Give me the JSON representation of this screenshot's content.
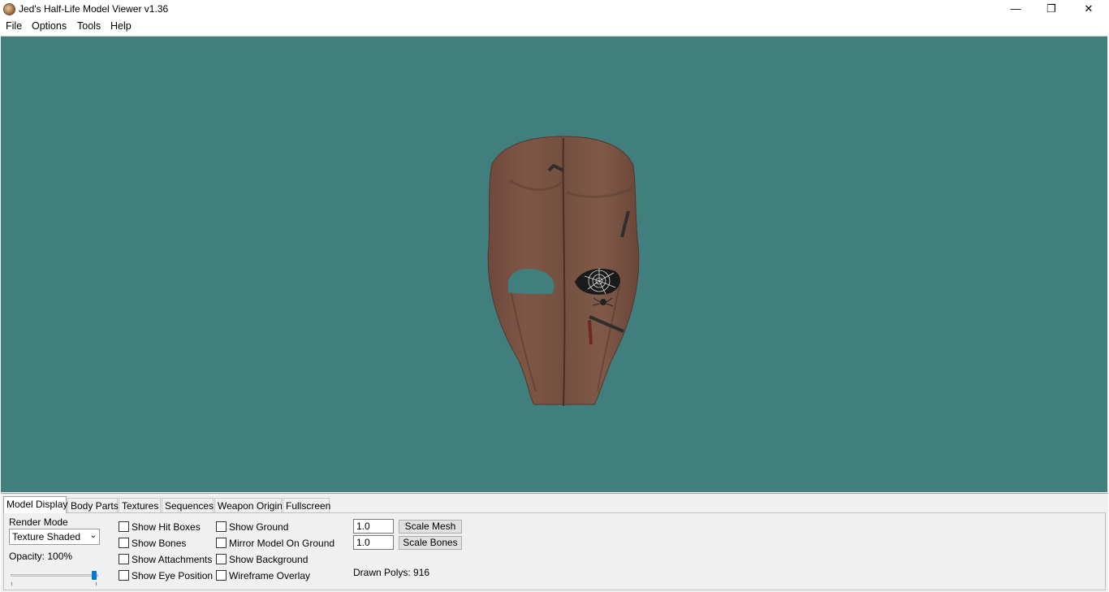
{
  "window": {
    "title": "Jed's Half-Life Model Viewer v1.36",
    "controls": {
      "minimize": "—",
      "restore": "❐",
      "close": "✕"
    }
  },
  "menu": [
    "File",
    "Options",
    "Tools",
    "Help"
  ],
  "viewport": {
    "background_color": "#417f7e",
    "model": "wooden-mask"
  },
  "tabs": [
    "Model Display",
    "Body Parts",
    "Textures",
    "Sequences",
    "Weapon Origin",
    "Fullscreen"
  ],
  "model_display": {
    "render_mode_label": "Render Mode",
    "render_mode_value": "Texture Shaded",
    "opacity_label": "Opacity: 100%",
    "opacity_value": 1.0,
    "checkboxes_col1": [
      "Show Hit Boxes",
      "Show Bones",
      "Show Attachments",
      "Show Eye Position"
    ],
    "checkboxes_col2": [
      "Show Ground",
      "Mirror Model On Ground",
      "Show Background",
      "Wireframe Overlay"
    ],
    "scale_mesh_value": "1.0",
    "scale_mesh_button": "Scale Mesh",
    "scale_bones_value": "1.0",
    "scale_bones_button": "Scale Bones",
    "drawn_polys": "Drawn Polys: 916"
  }
}
